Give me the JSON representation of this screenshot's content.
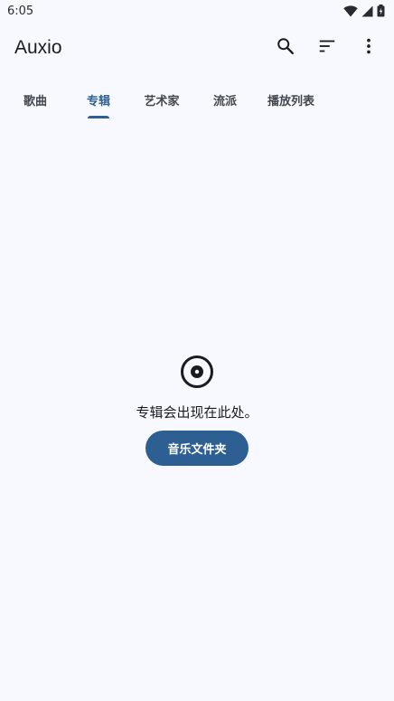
{
  "status_bar": {
    "time": "6:05",
    "icons": [
      "wifi-icon",
      "signal-icon",
      "battery-icon"
    ]
  },
  "app_bar": {
    "title": "Auxio",
    "actions": [
      "search-icon",
      "sort-icon",
      "more-vert-icon"
    ]
  },
  "tabs": [
    {
      "label": "歌曲",
      "active": false
    },
    {
      "label": "专辑",
      "active": true
    },
    {
      "label": "艺术家",
      "active": false
    },
    {
      "label": "流派",
      "active": false
    },
    {
      "label": "播放列表",
      "active": false
    }
  ],
  "empty_state": {
    "icon": "album-icon",
    "message": "专辑会出现在此处。",
    "button_label": "音乐文件夹"
  },
  "colors": {
    "background": "#f7f9ff",
    "accent": "#2d5f93",
    "text": "#1b1c20",
    "tab_inactive": "#43474e"
  }
}
